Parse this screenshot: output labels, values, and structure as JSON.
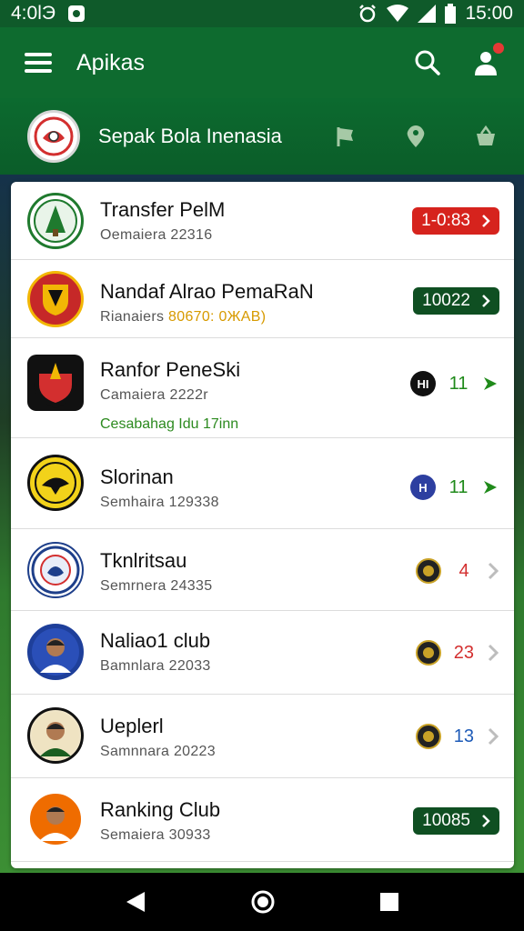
{
  "status_bar": {
    "time_left": "4:0lЭ",
    "time_right": "15:00"
  },
  "app_bar": {
    "title": "Apikas"
  },
  "league": {
    "title": "Sepak Bola Inenasia"
  },
  "rows": [
    {
      "name": "Transfer PelM",
      "sub": "Oemaiera  22316",
      "pill_text": "1-0:83",
      "pill_color": "red"
    },
    {
      "name": "Nandaf Alrao PemaRaN",
      "sub_prefix": "Rianaiers",
      "sub_highlight": "80670: 0ЖAB)",
      "pill_text": "10022",
      "pill_color": "dark"
    },
    {
      "name": "Ranfor PeneSki",
      "sub": "Camaiera  2222r",
      "note": "Cesabahag Idu 17inn",
      "mini_label": "HI",
      "mini_color": "#111111",
      "num": "11",
      "num_color": "#1f8a1a"
    },
    {
      "name": "Slorinan",
      "sub": "Semhaira  129338",
      "mini_label": "H",
      "mini_color": "#2d3fa0",
      "num": "11",
      "num_color": "#1f8a1a"
    },
    {
      "name": "Tknlritsau",
      "sub": "Semrnera  24335",
      "num": "4",
      "num_color": "#d32f2f"
    },
    {
      "name": "Naliao1 club",
      "sub": "Bamnlara  22033",
      "num": "23",
      "num_color": "#d32f2f"
    },
    {
      "name": "Ueplerl",
      "sub": "Samnnara  20223",
      "num": "13",
      "num_color": "#1e5bb8"
    },
    {
      "name": "Ranking Club",
      "sub": "Semaiera  30933",
      "pill_text": "10085",
      "pill_color": "dark"
    }
  ]
}
